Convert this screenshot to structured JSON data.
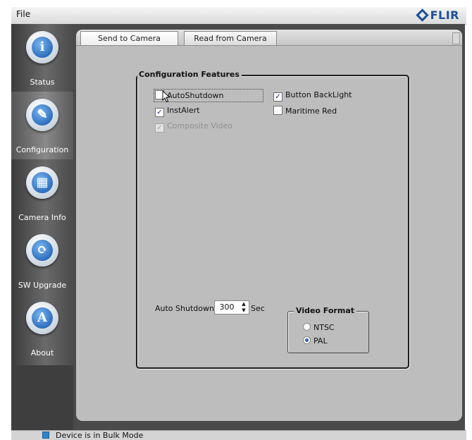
{
  "menubar": {
    "file_label": "File",
    "logo_text": "FLIR"
  },
  "sidebar": {
    "items": [
      {
        "label": "Status",
        "icon": "info-icon",
        "glyph": "i"
      },
      {
        "label": "Configuration",
        "icon": "configuration-icon",
        "glyph": "✎"
      },
      {
        "label": "Camera Info",
        "icon": "camera-info-icon",
        "glyph": "▦"
      },
      {
        "label": "SW Upgrade",
        "icon": "sw-upgrade-icon",
        "glyph": "⟳"
      },
      {
        "label": "About",
        "icon": "about-icon",
        "glyph": "A"
      }
    ],
    "active": "Configuration"
  },
  "tabs": [
    {
      "label": "Send to Camera"
    },
    {
      "label": "Read from Camera"
    }
  ],
  "config": {
    "legend": "Configuration Features",
    "auto_shutdown": {
      "label": "AutoShutdown",
      "checked": false
    },
    "button_backlight": {
      "label": "Button BackLight",
      "checked": true
    },
    "instalert": {
      "label": "InstAlert",
      "checked": true
    },
    "maritime_red": {
      "label": "Maritime Red",
      "checked": false
    },
    "composite_video": {
      "label": "Composite Video",
      "checked": true,
      "disabled": true
    },
    "auto_shutdown_time": {
      "label": "Auto Shutdown",
      "value": "300",
      "unit": "Sec"
    },
    "video_format": {
      "legend": "Video Format",
      "options": [
        "NTSC",
        "PAL"
      ],
      "selected": "PAL"
    }
  },
  "status": {
    "text": "Device is in Bulk Mode"
  },
  "colors": {
    "accent": "#1d4f9a",
    "panel": "#bdbdbd",
    "sidebar": "#555555"
  }
}
